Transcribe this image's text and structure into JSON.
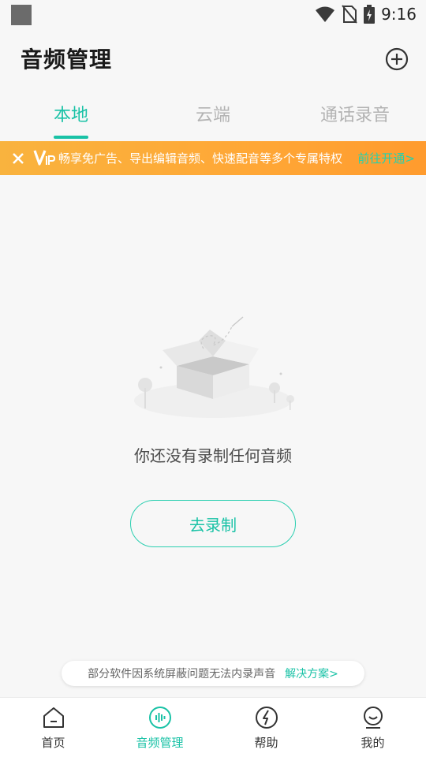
{
  "status_bar": {
    "time": "9:16"
  },
  "header": {
    "title": "音频管理"
  },
  "tabs": [
    {
      "label": "本地",
      "active": true
    },
    {
      "label": "云端",
      "active": false
    },
    {
      "label": "通话录音",
      "active": false
    }
  ],
  "vip_banner": {
    "text": "畅享免广告、导出编辑音频、快速配音等多个专属特权",
    "link": "前往开通>"
  },
  "empty_state": {
    "message": "你还没有录制任何音频",
    "button": "去录制"
  },
  "tip": {
    "text": "部分软件因系统屏蔽问题无法内录声音",
    "link": "解决方案>"
  },
  "bottom_nav": [
    {
      "label": "首页",
      "icon": "home-icon",
      "active": false
    },
    {
      "label": "音频管理",
      "icon": "audio-wave-icon",
      "active": true
    },
    {
      "label": "帮助",
      "icon": "help-icon",
      "active": false
    },
    {
      "label": "我的",
      "icon": "profile-icon",
      "active": false
    }
  ],
  "colors": {
    "accent": "#19c2a6",
    "banner": "#ffa736"
  }
}
